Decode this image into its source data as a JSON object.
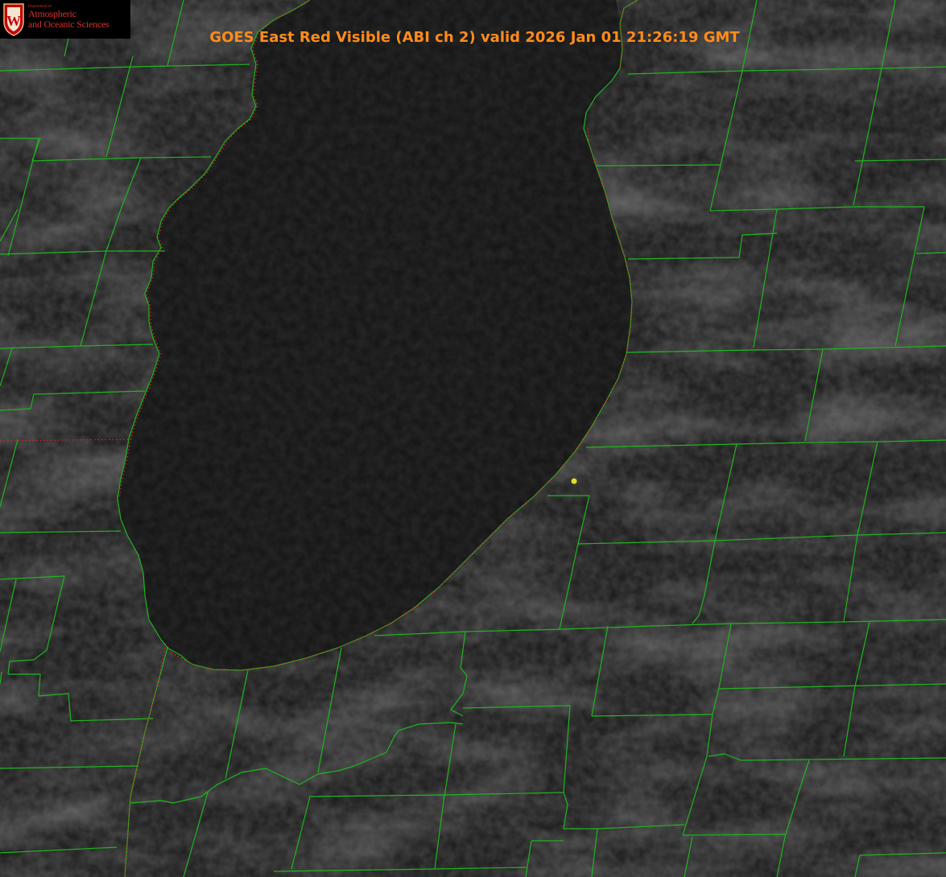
{
  "header": {
    "title": "GOES East Red Visible (ABI ch 2) valid 2026 Jan 01 21:26:19 GMT"
  },
  "logo": {
    "department": "Department of",
    "line1": "Atmospheric",
    "line2": "and Oceanic Sciences",
    "emblem_letter": "W"
  },
  "map": {
    "imagery": "satellite-visible",
    "colors": {
      "background": "#1d1d1d",
      "lake": "#151515",
      "county_lines": "#1fb51f",
      "state_lines": "#e0261f",
      "marker": "#e0e020",
      "title": "#ff8c1a"
    },
    "marker_icon": "station-marker-icon"
  }
}
